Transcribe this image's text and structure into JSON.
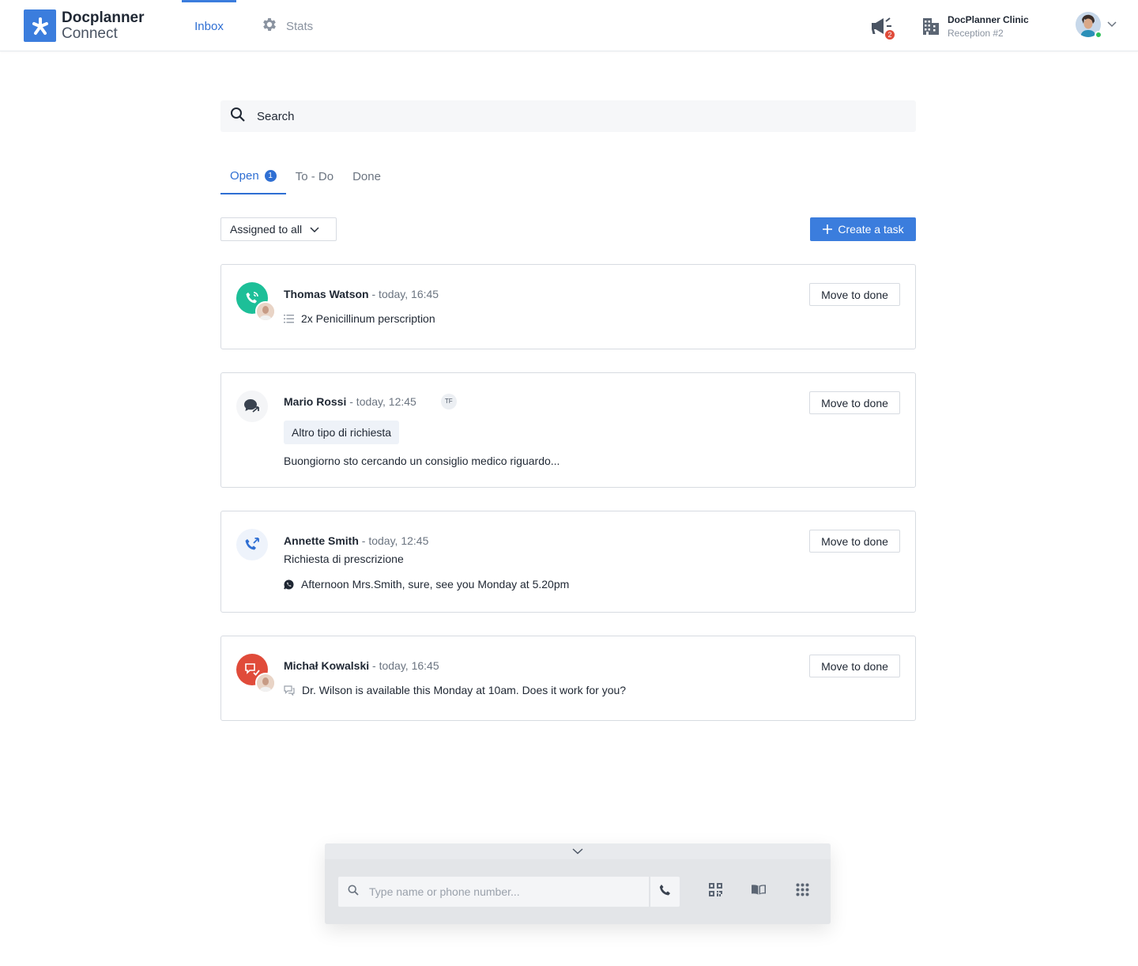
{
  "app": {
    "logo_title": "Docplanner",
    "logo_sub": "Connect"
  },
  "nav": {
    "inbox": "Inbox",
    "stats": "Stats"
  },
  "header": {
    "notifications_count": "2",
    "clinic_name": "DocPlanner Clinic",
    "clinic_sub": "Reception #2"
  },
  "search": {
    "placeholder": "Search"
  },
  "tabs": [
    {
      "label": "Open",
      "count": "1"
    },
    {
      "label": "To - Do"
    },
    {
      "label": "Done"
    }
  ],
  "filters": {
    "assigned": "Assigned to all",
    "create_task": "Create a task"
  },
  "cards": [
    {
      "name": "Thomas Watson",
      "time": " - today, 16:45",
      "line": "2x Penicillinum perscription",
      "action": "Move to done"
    },
    {
      "name": "Mario Rossi",
      "time": " - today, 12:45",
      "initials": "TF",
      "tag": "Altro tipo di richiesta",
      "line": "Buongiorno sto cercando un consiglio medico riguardo...",
      "action": "Move to done"
    },
    {
      "name": "Annette Smith",
      "time": " - today, 12:45",
      "subtitle": "Richiesta di prescrizione",
      "line": "Afternoon Mrs.Smith, sure,  see you Monday at 5.20pm",
      "action": "Move to done"
    },
    {
      "name": "Michał Kowalski",
      "time": " - today, 16:45",
      "line": "Dr. Wilson is available this Monday at 10am. Does it work for you?",
      "action": "Move to done"
    }
  ],
  "dialer": {
    "placeholder": "Type name or phone number..."
  },
  "colors": {
    "accent": "#3b7ddd",
    "call_green": "#1dbf98",
    "alert_red": "#e04b3a"
  }
}
